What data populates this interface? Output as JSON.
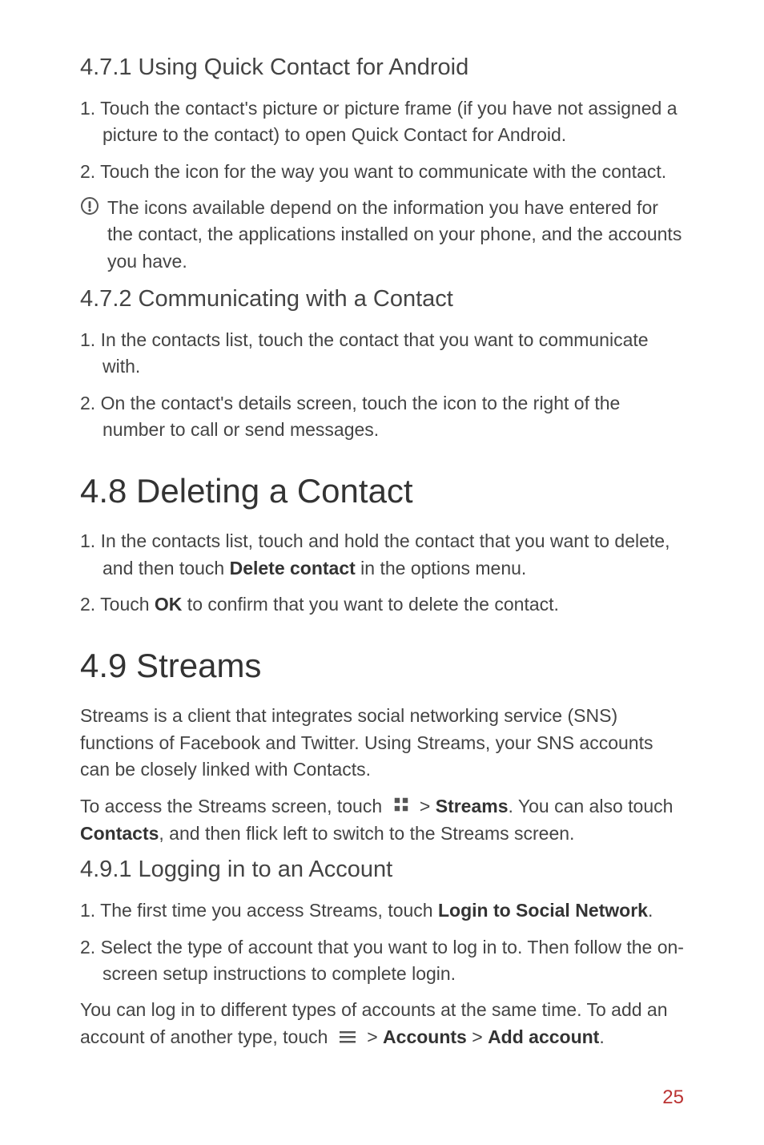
{
  "sections": {
    "s471": {
      "heading": "4.7.1  Using Quick Contact for Android",
      "item1": "1. Touch the contact's picture or picture frame (if you have not assigned a picture to the contact) to open Quick Contact for Android.",
      "item2": "2. Touch the icon for the way you want to communicate with the contact.",
      "note": "The icons available depend on the information you have entered for the contact, the applications installed on your phone, and the accounts you have."
    },
    "s472": {
      "heading": "4.7.2  Communicating with a Contact",
      "item1": "1. In the contacts list, touch the contact that you want to communicate with.",
      "item2": "2. On the contact's details screen, touch the icon to the right of the number to call or send messages."
    },
    "s48": {
      "heading": "4.8  Deleting a Contact",
      "item1_pre": "1. In the contacts list, touch and hold the contact that you want to delete, and then touch ",
      "item1_bold": "Delete contact",
      "item1_post": " in the options menu.",
      "item2_pre": "2. Touch ",
      "item2_bold": "OK",
      "item2_post": " to confirm that you want to delete the contact."
    },
    "s49": {
      "heading": "4.9  Streams",
      "para1": "Streams is a client that integrates social networking service (SNS) functions of Facebook and Twitter. Using Streams, your SNS accounts can be closely linked with Contacts.",
      "para2_pre": "To access the Streams screen, touch ",
      "para2_mid1": " > ",
      "para2_bold1": "Streams",
      "para2_mid2": ". You can also touch ",
      "para2_bold2": "Contacts",
      "para2_post": ", and then flick left to switch to the Streams screen."
    },
    "s491": {
      "heading": "4.9.1  Logging in to an Account",
      "item1_pre": "1. The first time you access Streams, touch ",
      "item1_bold": "Login to Social Network",
      "item1_post": ".",
      "item2": "2. Select the type of account that you want to log in to. Then follow the on-screen setup instructions to complete login.",
      "para_pre": "You can log in to different types of accounts at the same time. To add an account of another type, touch ",
      "para_mid1": " > ",
      "para_bold1": "Accounts",
      "para_mid2": " > ",
      "para_bold2": "Add account",
      "para_post": "."
    }
  },
  "page_number": "25"
}
